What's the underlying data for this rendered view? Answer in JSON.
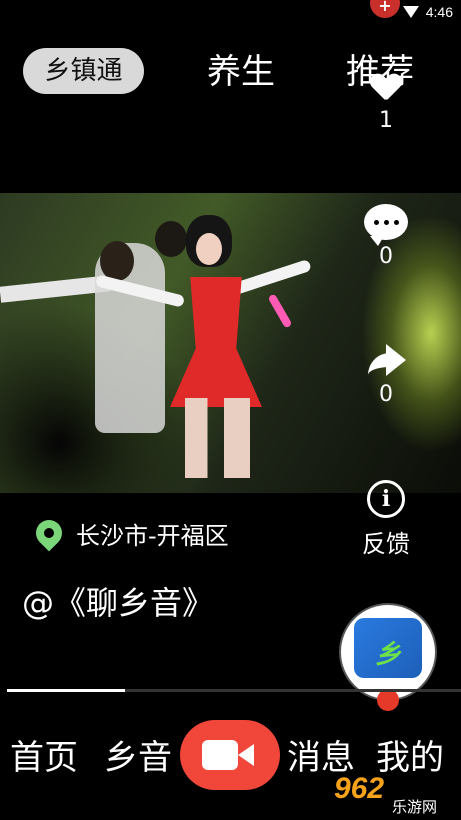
{
  "status_bar": {
    "time": "4:46",
    "notification_badge": "+"
  },
  "top_tabs": {
    "active": "乡镇通",
    "health": "养生",
    "recommend": "推荐"
  },
  "actions": {
    "like_count": "1",
    "comment_count": "0",
    "share_count": "0",
    "feedback_label": "反馈",
    "icons": [
      "heart-icon",
      "comment-icon",
      "share-icon",
      "info-icon"
    ]
  },
  "post": {
    "location": "长沙市-开福区",
    "author": "@《聊乡音》"
  },
  "playback": {
    "progress": 0.26
  },
  "bottom_nav": {
    "home": "首页",
    "voice": "乡音",
    "messages": "消息",
    "mine": "我的"
  },
  "watermark": {
    "brand": "962",
    "site": "乐游网"
  },
  "colors": {
    "background": "#000000",
    "record_button": "#f1463a",
    "pin": "#7bd67a",
    "pill": "#d9d9d9"
  }
}
